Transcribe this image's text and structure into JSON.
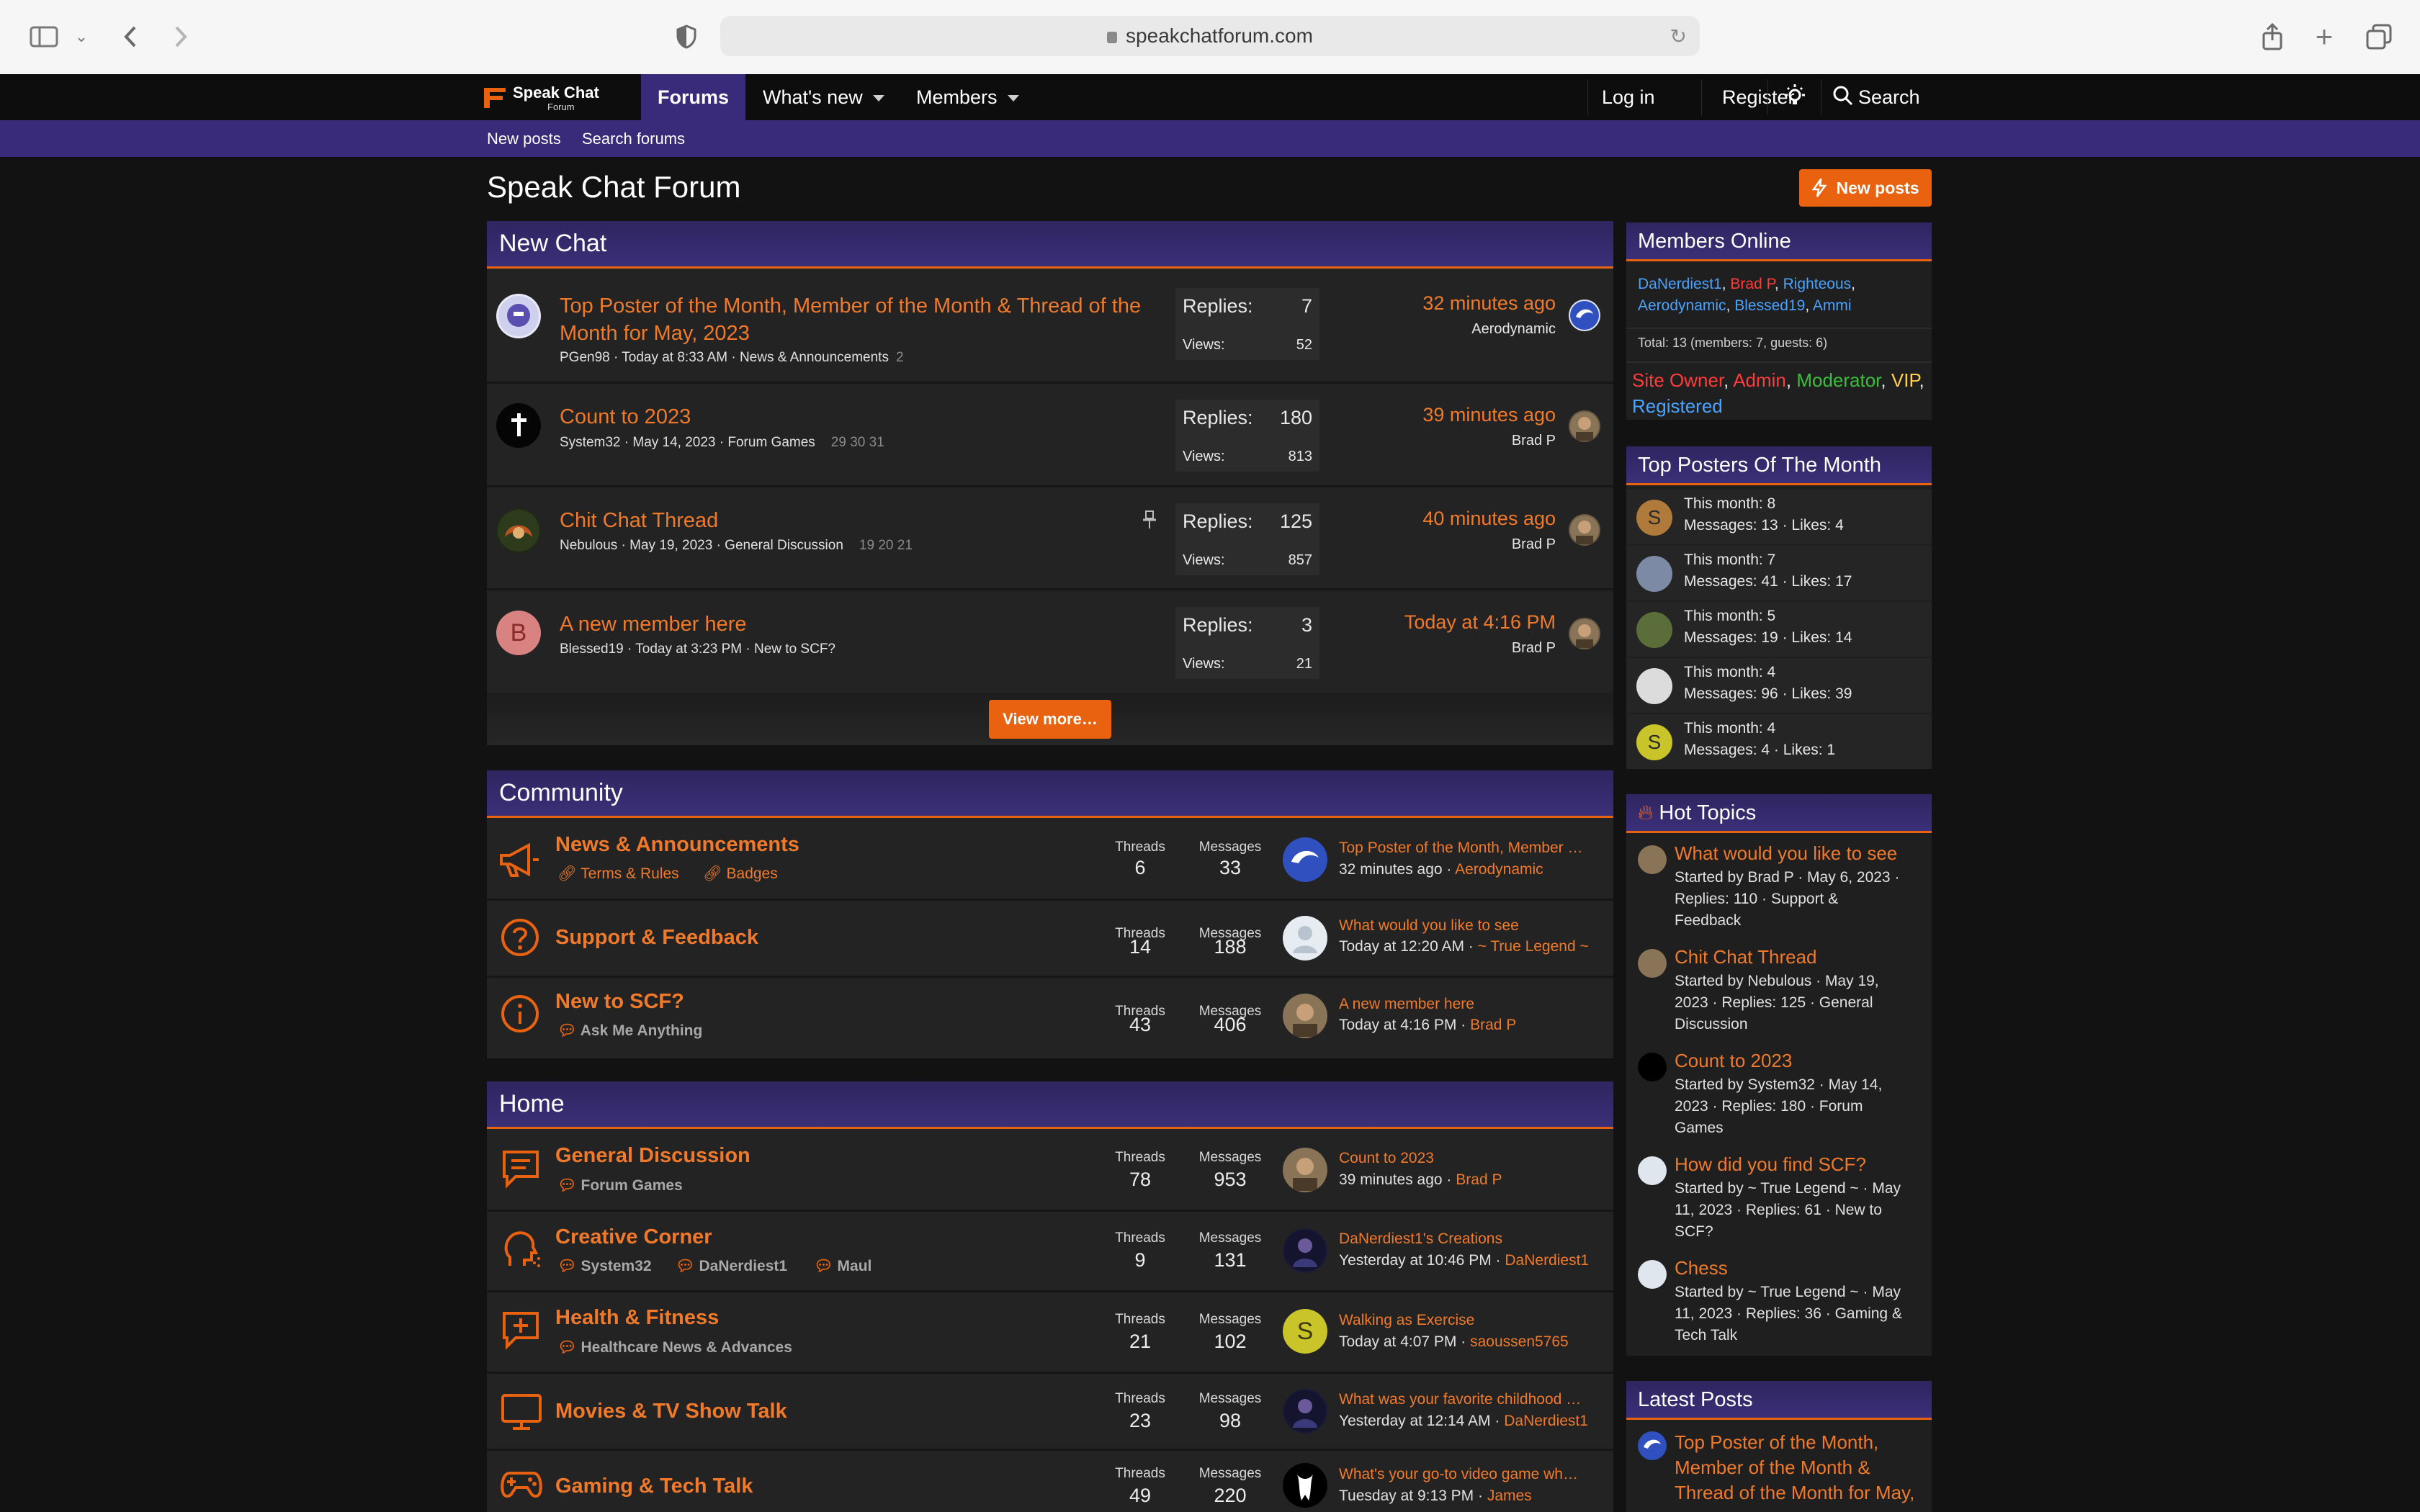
{
  "browser": {
    "url": "speakchatforum.com"
  },
  "nav": {
    "logo_line1": "Speak Chat",
    "logo_line2": "Forum",
    "forums": "Forums",
    "whats_new": "What's new",
    "members": "Members",
    "login": "Log in",
    "register": "Register",
    "search": "Search",
    "sub_new_posts": "New posts",
    "sub_search_forums": "Search forums"
  },
  "page": {
    "title": "Speak Chat Forum",
    "new_posts_button": "New posts"
  },
  "new_chat": {
    "title": "New Chat",
    "replies_label": "Replies:",
    "views_label": "Views:",
    "view_more": "View more…",
    "threads": [
      {
        "title_1": "Top Poster of the Month, Member of the Month & Thread of the",
        "title_2": "Month for May, 2023",
        "meta": "PGen98 · Today at 8:33 AM · News & Announcements",
        "pages": "2",
        "replies": "7",
        "views": "52",
        "last_time": "32 minutes ago",
        "last_user": "Aerodynamic"
      },
      {
        "title_1": "Count to 2023",
        "title_2": "",
        "meta": "System32 · May 14, 2023 · Forum Games",
        "pages": "29   30   31",
        "replies": "180",
        "views": "813",
        "last_time": "39 minutes ago",
        "last_user": "Brad P"
      },
      {
        "title_1": "Chit Chat Thread",
        "title_2": "",
        "meta": "Nebulous · May 19, 2023 · General Discussion",
        "pages": "19   20   21",
        "replies": "125",
        "views": "857",
        "last_time": "40 minutes ago",
        "last_user": "Brad P"
      },
      {
        "title_1": "A new member here",
        "title_2": "",
        "meta": "Blessed19 · Today at 3:23 PM · New to SCF?",
        "pages": "",
        "replies": "3",
        "views": "21",
        "last_time": "Today at 4:16 PM",
        "last_user": "Brad P",
        "avatar_letter": "B"
      }
    ]
  },
  "columns": {
    "threads": "Threads",
    "messages": "Messages"
  },
  "community": {
    "title": "Community",
    "forums": [
      {
        "name": "News & Announcements",
        "subs": [
          "Terms & Rules",
          "Badges"
        ],
        "threads": "6",
        "messages": "33",
        "lp_title": "Top Poster of the Month, Member …",
        "lp_time": "32 minutes ago ·",
        "lp_user": "Aerodynamic"
      },
      {
        "name": "Support & Feedback",
        "subs": [],
        "threads": "14",
        "messages": "188",
        "lp_title": "What would you like to see",
        "lp_time": "Today at 12:20 AM ·",
        "lp_user": "~ True Legend ~"
      },
      {
        "name": "New to SCF?",
        "subs": [
          "Ask Me Anything"
        ],
        "threads": "43",
        "messages": "406",
        "lp_title": "A new member here",
        "lp_time": "Today at 4:16 PM ·",
        "lp_user": "Brad P"
      }
    ]
  },
  "home": {
    "title": "Home",
    "forums": [
      {
        "name": "General Discussion",
        "subs": [
          "Forum Games"
        ],
        "threads": "78",
        "messages": "953",
        "lp_title": "Count to 2023",
        "lp_time": "39 minutes ago ·",
        "lp_user": "Brad P"
      },
      {
        "name": "Creative Corner",
        "subs": [
          "System32",
          "DaNerdiest1",
          "Maul"
        ],
        "threads": "9",
        "messages": "131",
        "lp_title": "DaNerdiest1's Creations",
        "lp_time": "Yesterday at 10:46 PM ·",
        "lp_user": "DaNerdiest1"
      },
      {
        "name": "Health & Fitness",
        "subs": [
          "Healthcare News & Advances"
        ],
        "threads": "21",
        "messages": "102",
        "lp_title": "Walking as Exercise",
        "lp_time": "Today at 4:07 PM ·",
        "lp_user": "saoussen5765",
        "avatar_letter": "S"
      },
      {
        "name": "Movies & TV Show Talk",
        "subs": [],
        "threads": "23",
        "messages": "98",
        "lp_title": "What was your favorite childhood …",
        "lp_time": "Yesterday at 12:14 AM ·",
        "lp_user": "DaNerdiest1"
      },
      {
        "name": "Gaming & Tech Talk",
        "subs": [],
        "threads": "49",
        "messages": "220",
        "lp_title": "What's your go-to video game wh…",
        "lp_time": "Tuesday at 9:13 PM ·",
        "lp_user": "James"
      }
    ]
  },
  "sidebar": {
    "members_online": {
      "title": "Members Online",
      "names": [
        {
          "name": "DaNerdiest1",
          "color": "#4aa3ff"
        },
        {
          "name": "Brad P",
          "color": "#ff3b3b"
        },
        {
          "name": "Righteous",
          "color": "#4aa3ff"
        },
        {
          "name": "Aerodynamic",
          "color": "#4aa3ff"
        },
        {
          "name": "Blessed19",
          "color": "#4aa3ff"
        },
        {
          "name": "Ammi",
          "color": "#4aa3ff"
        }
      ],
      "total": "Total: 13 (members: 7, guests: 6)",
      "roles": [
        {
          "name": "Site Owner",
          "color": "#ff3b3b"
        },
        {
          "name": "Admin",
          "color": "#ff3b3b"
        },
        {
          "name": "Moderator",
          "color": "#3bbf3b"
        },
        {
          "name": "VIP",
          "color": "#ffd24a"
        },
        {
          "name": "Registered",
          "color": "#4aa3ff"
        }
      ]
    },
    "top_posters": {
      "title": "Top Posters Of The Month",
      "rows": [
        {
          "month": "This month: 8",
          "stats": "Messages: 13 · Likes: 4",
          "letter": "S",
          "color": "#b07a3a"
        },
        {
          "month": "This month: 7",
          "stats": "Messages: 41 · Likes: 17",
          "letter": "",
          "color": "#7d8aa6"
        },
        {
          "month": "This month: 5",
          "stats": "Messages: 19 · Likes: 14",
          "letter": "",
          "color": "#5b6e3a"
        },
        {
          "month": "This month: 4",
          "stats": "Messages: 96 · Likes: 39",
          "letter": "",
          "color": "#dcdcdc"
        },
        {
          "month": "This month: 4",
          "stats": "Messages: 4 · Likes: 1",
          "letter": "S",
          "color": "#c9c42a"
        }
      ]
    },
    "hot_topics": {
      "title": "Hot Topics",
      "items": [
        {
          "title": "What would you like to see",
          "meta_1": "Started by Brad P · May 6, 2023 ·",
          "meta_2": "Replies: 110 · Support &",
          "meta_3": "Feedback"
        },
        {
          "title": "Chit Chat Thread",
          "meta_1": "Started by Nebulous · May 19,",
          "meta_2": "2023 · Replies: 125 · General",
          "meta_3": "Discussion"
        },
        {
          "title": "Count to 2023",
          "meta_1": "Started by System32 · May 14,",
          "meta_2": "2023 · Replies: 180 · Forum",
          "meta_3": "Games"
        },
        {
          "title": "How did you find SCF?",
          "meta_1": "Started by ~ True Legend ~ · May",
          "meta_2": "11, 2023 · Replies: 61 · New to",
          "meta_3": "SCF?"
        },
        {
          "title": "Chess",
          "meta_1": "Started by ~ True Legend ~ · May",
          "meta_2": "11, 2023 · Replies: 36 · Gaming &",
          "meta_3": "Tech Talk"
        }
      ]
    },
    "latest_posts": {
      "title": "Latest Posts",
      "item_1": "Top Poster of the Month,",
      "item_2": "Member of the Month &",
      "item_3": "Thread of the Month for May,"
    }
  },
  "colors": {
    "accent": "#e8620f",
    "brand_purple": "#3a2b7a",
    "link_orange": "#f07a2a"
  }
}
